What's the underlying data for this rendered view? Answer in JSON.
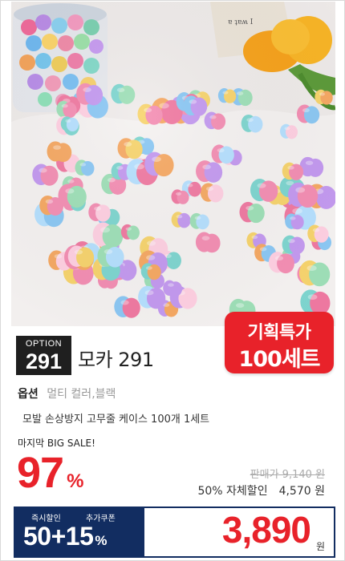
{
  "badge": {
    "line1": "기획특가",
    "line2": "100세트"
  },
  "option": {
    "label": "OPTION",
    "number": "291"
  },
  "product_title": "모카 291",
  "option_row": {
    "key": "옵션",
    "value": "멀티 컬러,블랙"
  },
  "description": "모발 손상방지 고무줄 케이스 100개 1세트",
  "sale": {
    "label": "마지막 BIG SALE!",
    "percent": "97",
    "percent_sign": "%",
    "original_price": "판매가  9,140 원",
    "discount_text": "50% 자체할인",
    "discount_price": "4,570 원"
  },
  "coupon": {
    "instant_label": "즉시할인",
    "extra_label": "추가쿠폰",
    "value": "50+15",
    "value_suffix": "%"
  },
  "final_price": {
    "amount": "3,890",
    "unit": "원"
  },
  "colors": {
    "accent_red": "#e8222a",
    "navy": "#122d61",
    "dark": "#1f1f1f"
  },
  "photo": {
    "subject": "colorful scrunchie hair ties scattered, jar and tulips"
  }
}
